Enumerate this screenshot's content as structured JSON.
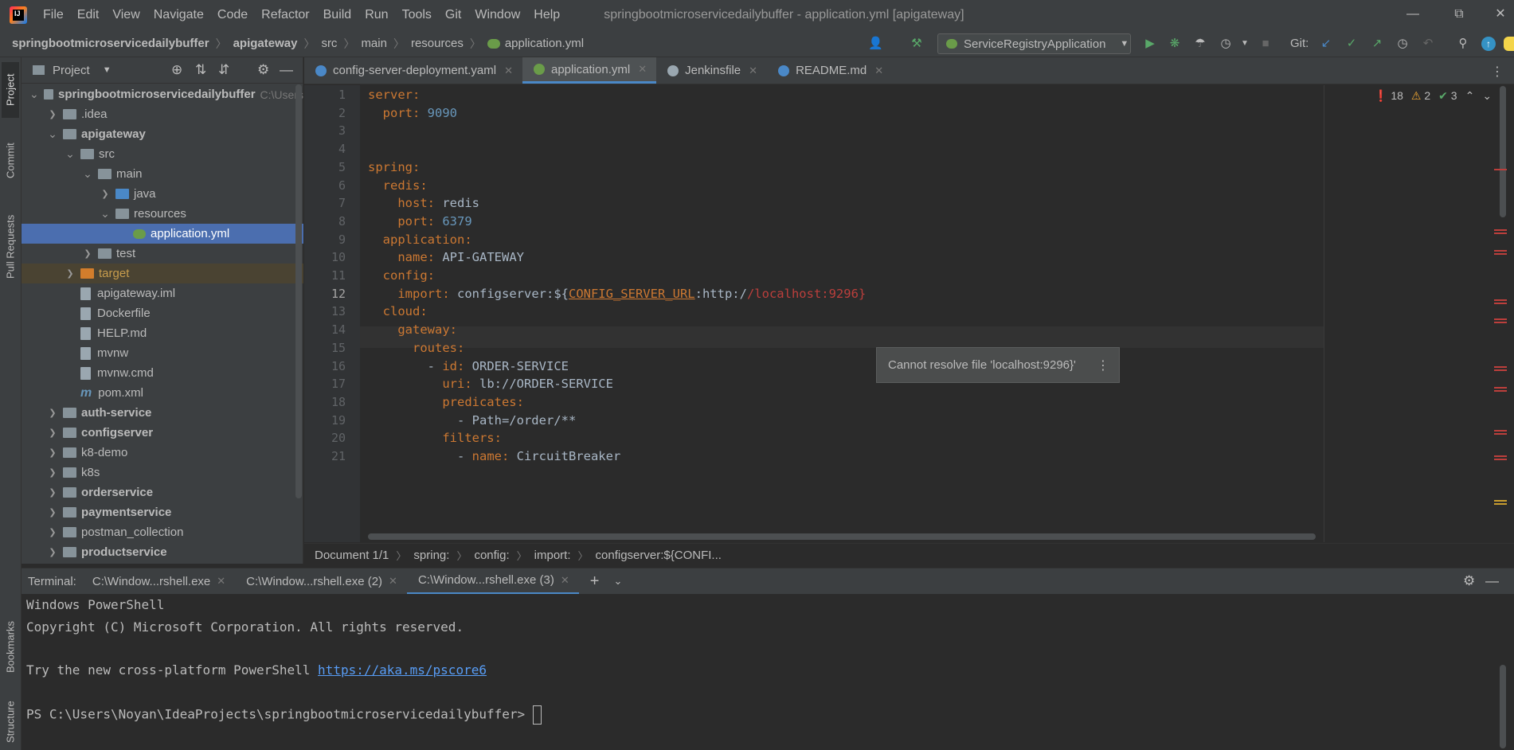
{
  "menu": [
    "File",
    "Edit",
    "View",
    "Navigate",
    "Code",
    "Refactor",
    "Build",
    "Run",
    "Tools",
    "Git",
    "Window",
    "Help"
  ],
  "window_title": "springbootmicroservicedailybuffer - application.yml [apigateway]",
  "breadcrumbs": [
    "springbootmicroservicedailybuffer",
    "apigateway",
    "src",
    "main",
    "resources",
    "application.yml"
  ],
  "run_config": "ServiceRegistryApplication",
  "git_label": "Git:",
  "left_strip": {
    "project": "Project",
    "commit": "Commit",
    "pull_requests": "Pull Requests",
    "bookmarks": "Bookmarks",
    "structure": "Structure"
  },
  "project_panel": {
    "title": "Project",
    "tree": [
      {
        "label": "springbootmicroservicedailybuffer",
        "hint": "C:\\Users",
        "depth": 0,
        "arrow": "open",
        "kind": "module",
        "bold": true
      },
      {
        "label": ".idea",
        "depth": 1,
        "arrow": "closed",
        "kind": "folder"
      },
      {
        "label": "apigateway",
        "depth": 1,
        "arrow": "open",
        "kind": "module",
        "bold": true
      },
      {
        "label": "src",
        "depth": 2,
        "arrow": "open",
        "kind": "folder"
      },
      {
        "label": "main",
        "depth": 3,
        "arrow": "open",
        "kind": "folder"
      },
      {
        "label": "java",
        "depth": 4,
        "arrow": "closed",
        "kind": "folder-blue"
      },
      {
        "label": "resources",
        "depth": 4,
        "arrow": "open",
        "kind": "folder"
      },
      {
        "label": "application.yml",
        "depth": 5,
        "arrow": "none",
        "kind": "yml",
        "selected": true
      },
      {
        "label": "test",
        "depth": 3,
        "arrow": "closed",
        "kind": "folder"
      },
      {
        "label": "target",
        "depth": 2,
        "arrow": "closed",
        "kind": "folder-orange",
        "excluded": true
      },
      {
        "label": "apigateway.iml",
        "depth": 2,
        "arrow": "none",
        "kind": "file"
      },
      {
        "label": "Dockerfile",
        "depth": 2,
        "arrow": "none",
        "kind": "file"
      },
      {
        "label": "HELP.md",
        "depth": 2,
        "arrow": "none",
        "kind": "file"
      },
      {
        "label": "mvnw",
        "depth": 2,
        "arrow": "none",
        "kind": "file"
      },
      {
        "label": "mvnw.cmd",
        "depth": 2,
        "arrow": "none",
        "kind": "file"
      },
      {
        "label": "pom.xml",
        "depth": 2,
        "arrow": "none",
        "kind": "maven"
      },
      {
        "label": "auth-service",
        "depth": 1,
        "arrow": "closed",
        "kind": "module",
        "bold": true
      },
      {
        "label": "configserver",
        "depth": 1,
        "arrow": "closed",
        "kind": "module",
        "bold": true
      },
      {
        "label": "k8-demo",
        "depth": 1,
        "arrow": "closed",
        "kind": "folder"
      },
      {
        "label": "k8s",
        "depth": 1,
        "arrow": "closed",
        "kind": "folder"
      },
      {
        "label": "orderservice",
        "depth": 1,
        "arrow": "closed",
        "kind": "module",
        "bold": true
      },
      {
        "label": "paymentservice",
        "depth": 1,
        "arrow": "closed",
        "kind": "module",
        "bold": true
      },
      {
        "label": "postman_collection",
        "depth": 1,
        "arrow": "closed",
        "kind": "folder"
      },
      {
        "label": "productservice",
        "depth": 1,
        "arrow": "closed",
        "kind": "module",
        "bold": true
      }
    ]
  },
  "editor_tabs": [
    {
      "label": "config-server-deployment.yaml",
      "icon_color": "#4a88c7"
    },
    {
      "label": "application.yml",
      "icon_color": "#6a9c49",
      "active": true
    },
    {
      "label": "Jenkinsfile",
      "icon_color": "#9aa7b0"
    },
    {
      "label": "README.md",
      "icon_color": "#4a88c7"
    }
  ],
  "problems": {
    "errors": "18",
    "warnings": "2",
    "ok": "3"
  },
  "code_lines": [
    [
      {
        "t": "server",
        "c": "k"
      },
      {
        "t": ":",
        "c": "k"
      }
    ],
    [
      {
        "t": "  port",
        "c": "k"
      },
      {
        "t": ": ",
        "c": "k"
      },
      {
        "t": "9090",
        "c": "n"
      }
    ],
    [],
    [],
    [
      {
        "t": "spring",
        "c": "k"
      },
      {
        "t": ":",
        "c": "k"
      }
    ],
    [
      {
        "t": "  redis",
        "c": "k"
      },
      {
        "t": ":",
        "c": "k"
      }
    ],
    [
      {
        "t": "    host",
        "c": "k"
      },
      {
        "t": ": ",
        "c": "k"
      },
      {
        "t": "redis",
        "c": "v"
      }
    ],
    [
      {
        "t": "    port",
        "c": "k"
      },
      {
        "t": ": ",
        "c": "k"
      },
      {
        "t": "6379",
        "c": "n"
      }
    ],
    [
      {
        "t": "  application",
        "c": "k"
      },
      {
        "t": ":",
        "c": "k"
      }
    ],
    [
      {
        "t": "    name",
        "c": "k"
      },
      {
        "t": ": ",
        "c": "k"
      },
      {
        "t": "API-GATEWAY",
        "c": "v"
      }
    ],
    [
      {
        "t": "  config",
        "c": "k"
      },
      {
        "t": ":",
        "c": "k"
      }
    ],
    [
      {
        "t": "    import",
        "c": "k"
      },
      {
        "t": ": ",
        "c": "k"
      },
      {
        "t": "configserver",
        "c": "v"
      },
      {
        "t": ":${",
        "c": "v"
      },
      {
        "t": "CONFIG_SERVER_URL",
        "c": "k under"
      },
      {
        "t": ":http:/",
        "c": "v"
      },
      {
        "t": "/localhost:9296}",
        "c": "red"
      }
    ],
    [
      {
        "t": "  cloud",
        "c": "k"
      },
      {
        "t": ":",
        "c": "k"
      }
    ],
    [
      {
        "t": "    gateway",
        "c": "k"
      },
      {
        "t": ":",
        "c": "k"
      }
    ],
    [
      {
        "t": "      routes",
        "c": "k"
      },
      {
        "t": ":",
        "c": "k"
      }
    ],
    [
      {
        "t": "        - ",
        "c": "v"
      },
      {
        "t": "id",
        "c": "k"
      },
      {
        "t": ": ",
        "c": "k"
      },
      {
        "t": "ORDER-SERVICE",
        "c": "v"
      }
    ],
    [
      {
        "t": "          uri",
        "c": "k"
      },
      {
        "t": ": ",
        "c": "k"
      },
      {
        "t": "lb://ORDER-SERVICE",
        "c": "v"
      }
    ],
    [
      {
        "t": "          predicates",
        "c": "k"
      },
      {
        "t": ":",
        "c": "k"
      }
    ],
    [
      {
        "t": "            - Path=/order/**",
        "c": "v"
      }
    ],
    [
      {
        "t": "          filters",
        "c": "k"
      },
      {
        "t": ":",
        "c": "k"
      }
    ],
    [
      {
        "t": "            - ",
        "c": "v"
      },
      {
        "t": "name",
        "c": "k"
      },
      {
        "t": ": ",
        "c": "k"
      },
      {
        "t": "CircuitBreaker",
        "c": "v"
      }
    ]
  ],
  "current_line": 12,
  "tooltip": "Cannot resolve file 'localhost:9296}'",
  "editor_breadcrumb": [
    "Document 1/1",
    "spring:",
    "config:",
    "import:",
    "configserver:${CONFI..."
  ],
  "terminal": {
    "label": "Terminal:",
    "tabs": [
      "C:\\Window...rshell.exe",
      "C:\\Window...rshell.exe (2)",
      "C:\\Window...rshell.exe (3)"
    ],
    "lines": [
      "Windows PowerShell",
      "Copyright (C) Microsoft Corporation. All rights reserved.",
      "",
      "Try the new cross-platform PowerShell ",
      "",
      "PS C:\\Users\\Noyan\\IdeaProjects\\springbootmicroservicedailybuffer> "
    ],
    "link": "https://aka.ms/pscore6"
  }
}
